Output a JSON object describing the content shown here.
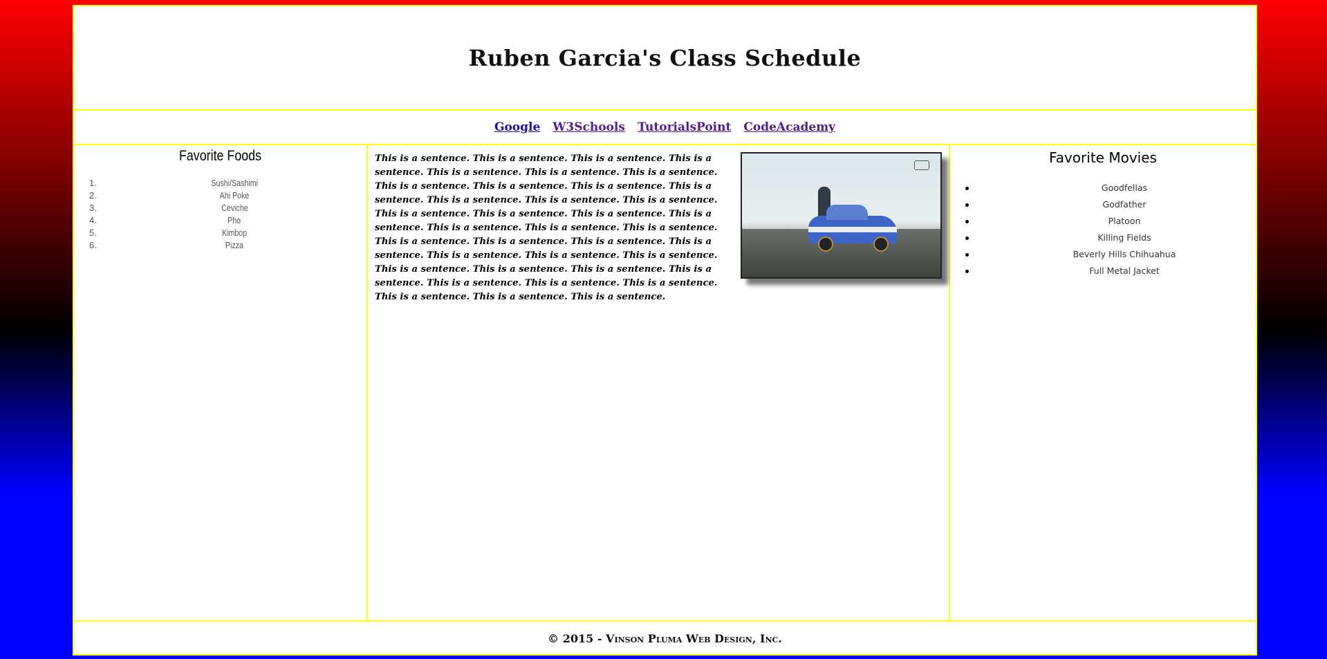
{
  "header": {
    "title": "Ruben Garcia's Class Schedule"
  },
  "nav": {
    "links": [
      {
        "label": "Google",
        "state": "unvisited"
      },
      {
        "label": "W3Schools",
        "state": "visited"
      },
      {
        "label": "TutorialsPoint",
        "state": "visited"
      },
      {
        "label": "CodeAcademy",
        "state": "visited"
      }
    ]
  },
  "left": {
    "heading": "Favorite Foods",
    "items": [
      {
        "num": "1.",
        "label": "Sushi/Sashimi"
      },
      {
        "num": "2.",
        "label": "Ahi Poke"
      },
      {
        "num": "3.",
        "label": "Ceviche"
      },
      {
        "num": "4.",
        "label": "Pho"
      },
      {
        "num": "5.",
        "label": "Kimbop"
      },
      {
        "num": "6.",
        "label": "Pizza"
      }
    ]
  },
  "main": {
    "paragraph": "This is a sentence. This is a sentence. This is a sentence. This is a sentence. This is a sentence. This is a sentence. This is a sentence. This is a sentence. This is a sentence. This is a sentence. This is a sentence. This is a sentence. This is a sentence. This is a sentence. This is a sentence. This is a sentence. This is a sentence. This is a sentence. This is a sentence. This is a sentence. This is a sentence. This is a sentence. This is a sentence. This is a sentence. This is a sentence. This is a sentence. This is a sentence. This is a sentence. This is a sentence. This is a sentence. This is a sentence. This is a sentence. This is a sentence. This is a sentence. This is a sentence. This is a sentence. This is a sentence. This is a sentence."
  },
  "right": {
    "heading": "Favorite Movies",
    "items": [
      "Goodfellas",
      "Godfather",
      "Platoon",
      "Killing Fields",
      "Beverly Hills Chihuahua",
      "Full Metal Jacket"
    ]
  },
  "footer": {
    "text": "© 2015 - Vinson Pluma Web Design, Inc."
  }
}
